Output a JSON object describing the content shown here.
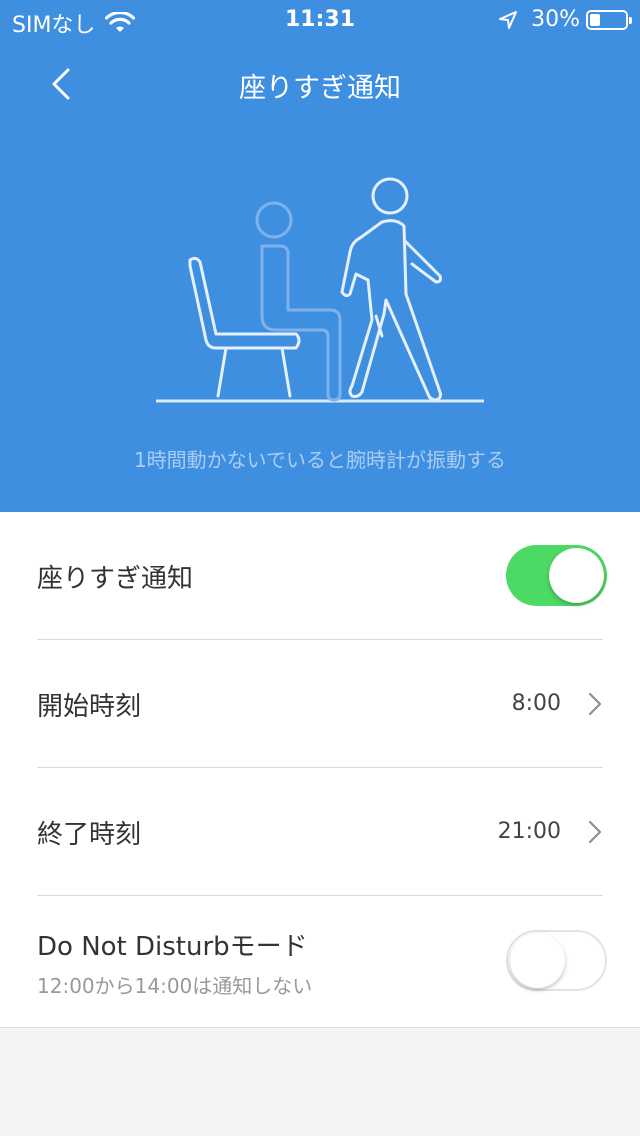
{
  "status_bar": {
    "carrier": "SIMなし",
    "time": "11:31",
    "battery_percent": "30%",
    "battery_level": 0.3,
    "icons": [
      "wifi-icon",
      "location-arrow-icon",
      "battery-icon"
    ]
  },
  "nav": {
    "title": "座りすぎ通知",
    "back_icon": "chevron-left-icon"
  },
  "hero": {
    "description": "1時間動かないでいると腕時計が振動する",
    "illustration": "sitting-and-walking-person"
  },
  "settings": {
    "sedentary_toggle": {
      "label": "座りすぎ通知",
      "on": true
    },
    "start_time": {
      "label": "開始時刻",
      "value": "8:00"
    },
    "end_time": {
      "label": "終了時刻",
      "value": "21:00"
    },
    "dnd": {
      "label": "Do Not Disturbモード",
      "sublabel": "12:00から14:00は通知しない",
      "on": false
    }
  },
  "colors": {
    "header_blue": "#3f8fe0",
    "toggle_on_green": "#4cd964"
  }
}
